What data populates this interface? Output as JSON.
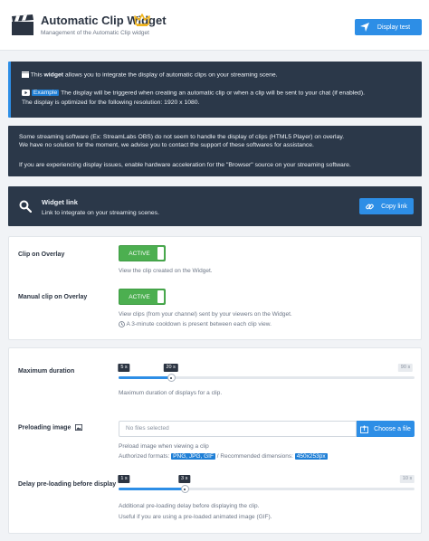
{
  "header": {
    "title": "Automatic Clip Widget",
    "subtitle": "Management of the Automatic Clip widget",
    "display_test_label": "Display test"
  },
  "info": {
    "intro_prefix": "This",
    "intro_bold": "widget",
    "intro_suffix": "allows you to integrate the display of automatic clips on your streaming scene.",
    "example_tag": "Example",
    "example_text": "The display will be triggered when creating an automatic clip or when a clip will be sent to your chat (if enabled).",
    "resolution_text": "The display is optimized for the following resolution: 1920 x 1080."
  },
  "warning": {
    "line1": "Some streaming software (Ex: StreamLabs OBS) do not seem to handle the display of clips (HTML5 Player) on overlay.",
    "line2": "We have no solution for the moment, we advise you to contact the support of these softwares for assistance.",
    "line3": "If you are experiencing display issues, enable hardware acceleration for the \"Browser\" source on your streaming software."
  },
  "widget_link": {
    "title": "Widget link",
    "description": "Link to integrate on your streaming scenes.",
    "copy_label": "Copy link"
  },
  "overlay": {
    "clip_on_overlay_label": "Clip on Overlay",
    "clip_on_overlay_state": "ACTIVE",
    "clip_on_overlay_help": "View the clip created on the Widget.",
    "manual_clip_label": "Manual clip on Overlay",
    "manual_clip_state": "ACTIVE",
    "manual_clip_help": "View clips (from your channel) sent by your viewers on the Widget.",
    "manual_clip_note": "A 3-minute cooldown is present between each clip view."
  },
  "settings": {
    "max_duration_label": "Maximum duration",
    "max_duration_min": "5 s",
    "max_duration_value": "20 s",
    "max_duration_max": "90 s",
    "max_duration_fraction": 0.1765,
    "max_duration_help": "Maximum duration of displays for a clip.",
    "preloading_label": "Preloading image",
    "no_file_text": "No files selected",
    "choose_file_label": "Choose a file",
    "preloading_help": "Preload image when viewing a clip",
    "authorized_prefix": "Authorized formats:",
    "formats_badge": "PNG, JPG, GIF",
    "dimensions_text": "/ Recommended dimensions:",
    "dimensions_badge": "450x253px",
    "delay_label": "Delay pre-loading before display",
    "delay_min": "1 s",
    "delay_value": "3 s",
    "delay_max": "10 s",
    "delay_fraction": 0.2222,
    "delay_help1": "Additional pre-loading delay before displaying the clip.",
    "delay_help2": "Useful if you are using a pre-loaded animated image (GIF)."
  }
}
